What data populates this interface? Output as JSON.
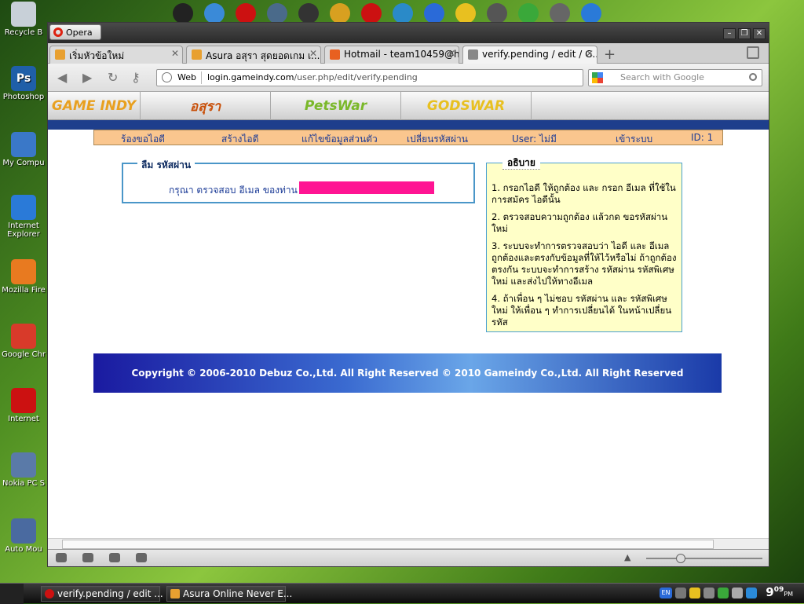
{
  "desktop": {
    "icons": [
      {
        "label": "Recycle B",
        "color": "#c8d0d8"
      },
      {
        "label": "Photoshop",
        "color": "#1f5fa8",
        "glyph": "Ps"
      },
      {
        "label": "My Compu",
        "color": "#3a78c8"
      },
      {
        "label": "Internet Explorer",
        "color": "#2a7ad8"
      },
      {
        "label": "Mozilla Fire",
        "color": "#e87a20"
      },
      {
        "label": "Google Chr",
        "color": "#d83a2a"
      },
      {
        "label": "Internet",
        "color": "#cc1111"
      },
      {
        "label": "Nokia PC S",
        "color": "#5a7aa8"
      },
      {
        "label": "Auto Mou",
        "color": "#4a6aa0"
      }
    ]
  },
  "window": {
    "menu_button": "Opera",
    "tabs": [
      {
        "label": "เริ่มหัวข้อใหม่",
        "icon_color": "#e8a030",
        "active": false
      },
      {
        "label": "Asura อสุรา สุดยอดเกม เ...",
        "icon_color": "#e8a030",
        "active": false
      },
      {
        "label": "Hotmail - team10459@h...",
        "icon_color": "#e86020",
        "active": false
      },
      {
        "label": "verify.pending / edit / G...",
        "icon_color": "#888888",
        "active": true
      }
    ],
    "address": {
      "engine_label": "Web",
      "domain": "login.gameindy.com",
      "path": "/user.php/edit/verify.pending"
    },
    "search": {
      "placeholder": "Search with Google"
    }
  },
  "page": {
    "games": [
      "GAME INDY",
      "อสุรา",
      "PetsWar",
      "GODSWAR"
    ],
    "menu": {
      "items": [
        "ร้องขอไอดี",
        "สร้างไอดี",
        "แก้ไขข้อมูลส่วนตัว",
        "เปลี่ยนรหัสผ่าน"
      ],
      "user": "User: ไม่มี",
      "login": "เข้าระบบ",
      "id": "ID: 1"
    },
    "forgot": {
      "legend": "ลืม รหัสผ่าน",
      "message": "กรุณา ตรวจสอบ อีเมล ของท่าน"
    },
    "explain": {
      "legend": "อธิบาย",
      "steps": [
        "1. กรอกไอดี ให้ถูกต้อง และ กรอก อีเมล ที่ใช้ในการสมัคร ไอดีนั้น",
        "2. ตรวจสอบความถูกต้อง แล้วกด ขอรหัสผ่านใหม่",
        "3. ระบบจะทำการตรวจสอบว่า ไอดี และ อีเมล ถูกต้องและตรงกับข้อมูลที่ให้ไว้หรือไม่ ถ้าถูกต้องตรงกัน ระบบจะทำการสร้าง รหัสผ่าน รหัสพิเศษใหม่ และส่งไปให้ทางอีเมล",
        "4. ถ้าเพื่อน ๆ ไม่ชอบ รหัสผ่าน และ รหัสพิเศษใหม่ ให้เพื่อน ๆ ทำการเปลี่ยนได้ ในหน้าเปลี่ยนรหัส"
      ]
    },
    "footer": "Copyright © 2006-2010 Debuz Co.,Ltd. All Right Reserved © 2010 Gameindy Co.,Ltd. All Right Reserved"
  },
  "taskbar": {
    "items": [
      {
        "label": "verify.pending / edit ...",
        "color": "#cc1111"
      },
      {
        "label": "Asura Online Never E...",
        "color": "#e8a030"
      }
    ],
    "language": "EN",
    "clock_hour": "9",
    "clock_min": "09",
    "clock_ampm": "PM"
  }
}
